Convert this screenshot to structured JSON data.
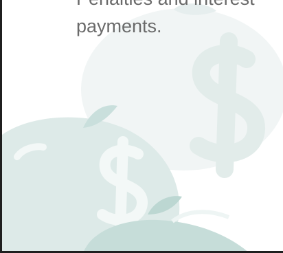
{
  "slide": {
    "text_lines": [
      "Penalties and interest",
      "payments."
    ],
    "colors": {
      "text": "#6a6a6a",
      "border": "#1f1f1f",
      "watermark_light": "#eef3f3",
      "watermark_mid": "#d6e6e4",
      "watermark_dark": "#cfe3e0"
    },
    "watermark": "apple-dollar-sign-watermark"
  }
}
